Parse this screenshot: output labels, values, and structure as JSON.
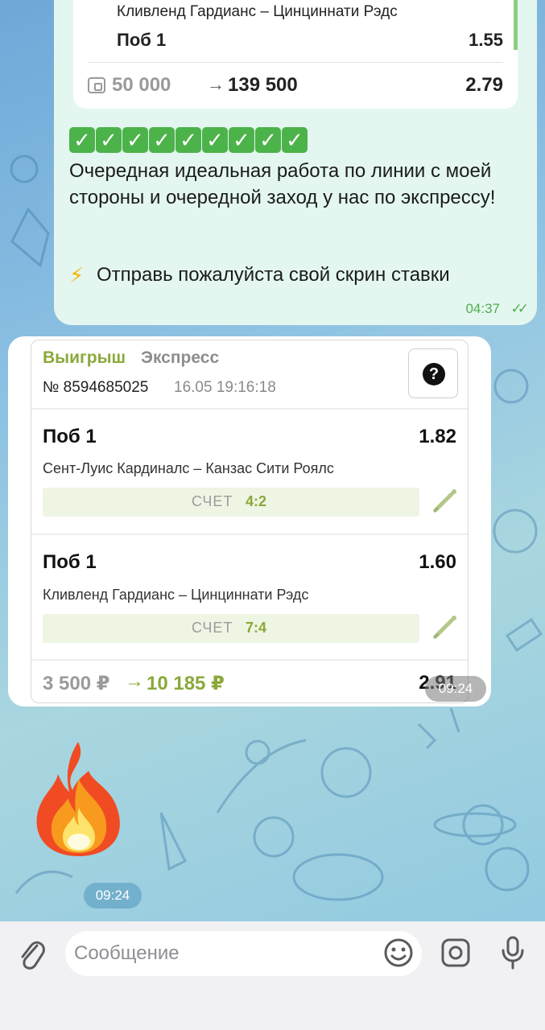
{
  "chat": {
    "outgoing": {
      "quote_card": {
        "match": "Кливленд Гардианс – Цинциннати Рэдс",
        "pick": "Поб 1",
        "odd": "1.55",
        "stake": "50 000",
        "arrow": "→",
        "payout": "139 500",
        "total_odd": "2.79"
      },
      "checks": [
        "✓",
        "✓",
        "✓",
        "✓",
        "✓",
        "✓",
        "✓",
        "✓",
        "✓"
      ],
      "text": "Очередная идеальная работа по линии с моей стороны и очередной заход у нас по экспрессу!",
      "bolt": "⚡",
      "cta": "Отправь пожалуйста свой скрин ставки",
      "time": "04:37",
      "ticks": "✓✓"
    },
    "incoming_ticket": {
      "status": "Выигрыш",
      "type": "Экспресс",
      "number": "№ 8594685025",
      "datetime": "16.05 19:16:18",
      "help": "?",
      "legs": [
        {
          "pick": "Поб 1",
          "odd": "1.82",
          "match": "Сент-Луис Кардиналс – Канзас Сити Роялс",
          "score_label": "СЧЕТ",
          "score": "4:2"
        },
        {
          "pick": "Поб 1",
          "odd": "1.60",
          "match": "Кливленд Гардианс – Цинциннати Рэдс",
          "score_label": "СЧЕТ",
          "score": "7:4"
        }
      ],
      "stake": "3 500 ₽",
      "arrow": "→",
      "payout": "10 185 ₽",
      "total_odd": "2.91",
      "time": "09:24"
    },
    "sticker": {
      "icon": "fire-icon",
      "time": "09:24"
    }
  },
  "composer": {
    "placeholder": "Сообщение"
  },
  "colors": {
    "accent_green": "#8aa93a",
    "check_green": "#4cb34a",
    "bubble_out": "#e3f7f0"
  }
}
